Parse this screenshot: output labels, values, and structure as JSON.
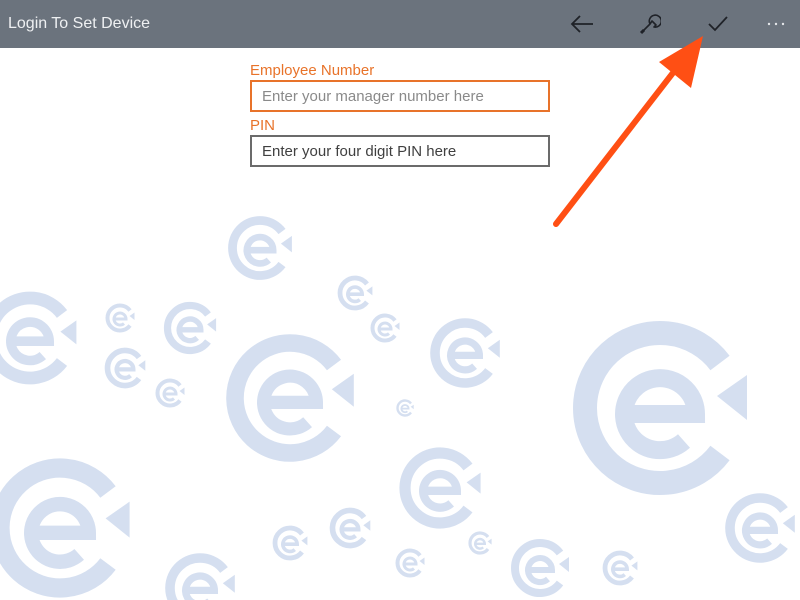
{
  "window": {
    "title": "Login To Set Device"
  },
  "toolbar": {
    "back_icon": "arrow-left-icon",
    "settings_icon": "wrench-icon",
    "accept_icon": "checkmark-icon",
    "more_icon": "ellipsis-icon"
  },
  "form": {
    "employee_number": {
      "label": "Employee Number",
      "placeholder": "Enter your manager number here",
      "value": ""
    },
    "pin": {
      "label": "PIN",
      "placeholder": "Enter your four digit PIN here",
      "value": ""
    }
  },
  "annotation": {
    "arrow_color": "#ff4f14",
    "points_to": "accept-button"
  },
  "colors": {
    "topbar": "#6b737d",
    "accent": "#e8732a",
    "pattern": "#c9d6ec"
  }
}
